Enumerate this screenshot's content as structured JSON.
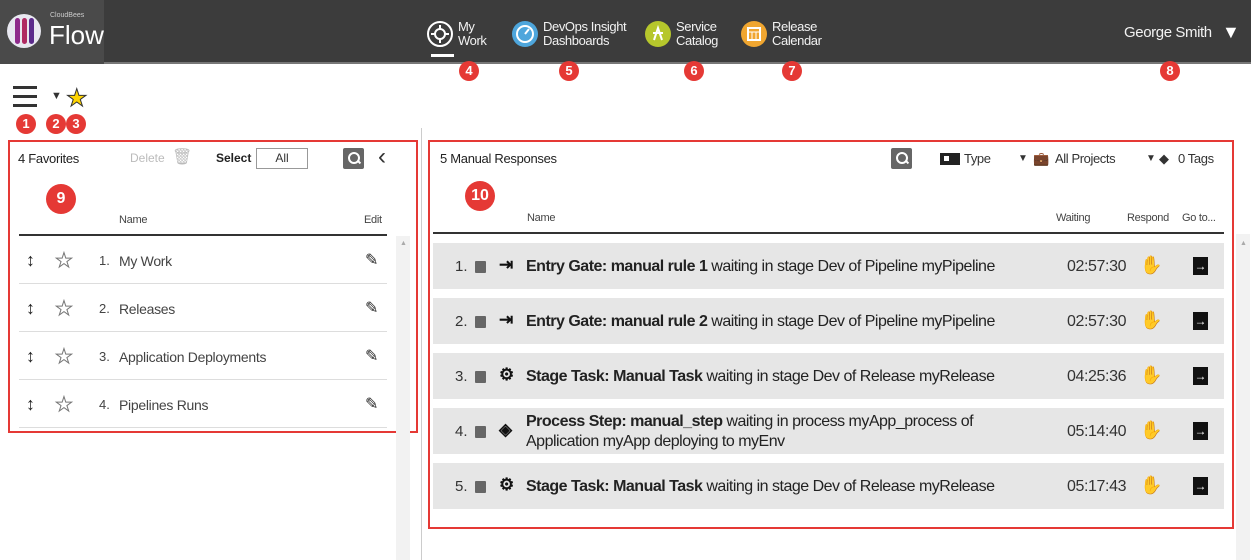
{
  "colors": {
    "accent": "#e53935",
    "topbar": "#3c3c3c",
    "star": "#ffd400"
  },
  "logo": {
    "small": "CloudBees",
    "name": "Flow"
  },
  "nav": [
    {
      "label": "My\nWork",
      "icon": "my-work-icon",
      "color": "#ffffff"
    },
    {
      "label": "DevOps Insight\nDashboards",
      "icon": "dashboard-gauge-icon",
      "color": "#4ea6dc"
    },
    {
      "label": "Service\nCatalog",
      "icon": "service-catalog-icon",
      "color": "#b6c72c"
    },
    {
      "label": "Release\nCalendar",
      "icon": "calendar-icon",
      "color": "#f0a630"
    }
  ],
  "user": {
    "name": "George Smith",
    "menu_icon": "caret-down-icon"
  },
  "toolbar": {
    "menu_icon": "hamburger-icon",
    "favorites_icon": "star-icon",
    "dropdown_icon": "caret-down-icon"
  },
  "callouts": [
    "1",
    "2",
    "3",
    "4",
    "5",
    "6",
    "7",
    "8",
    "9",
    "10"
  ],
  "favorites": {
    "title": "4 Favorites",
    "delete_label": "Delete",
    "select_label": "Select",
    "select_value": "All",
    "col_name": "Name",
    "col_edit": "Edit",
    "items": [
      {
        "num": "1.",
        "name": "My Work"
      },
      {
        "num": "2.",
        "name": "Releases"
      },
      {
        "num": "3.",
        "name": "Application Deployments"
      },
      {
        "num": "4.",
        "name": "Pipelines Runs"
      }
    ]
  },
  "responses": {
    "title": "5 Manual Responses",
    "filter_type": "Type",
    "filter_projects": "All Projects",
    "filter_tags": "0 Tags",
    "col_name": "Name",
    "col_waiting": "Waiting",
    "col_respond": "Respond",
    "col_goto": "Go to...",
    "rows": [
      {
        "num": "1.",
        "kind_icon": "gate-icon",
        "bold": "Entry Gate: manual rule 1",
        "rest": " waiting in stage Dev of Pipeline myPipeline",
        "time": "02:57:30"
      },
      {
        "num": "2.",
        "kind_icon": "gate-icon",
        "bold": "Entry Gate: manual rule 2",
        "rest": " waiting in stage Dev of Pipeline myPipeline",
        "time": "02:57:30"
      },
      {
        "num": "3.",
        "kind_icon": "gear-icon",
        "bold": "Stage Task: Manual Task",
        "rest": " waiting in stage Dev of Release myRelease",
        "time": "04:25:36"
      },
      {
        "num": "4.",
        "kind_icon": "process-step-icon",
        "bold": "Process Step: manual_step",
        "rest": " waiting in process myApp_process of Application myApp deploying to myEnv",
        "time": "05:14:40"
      },
      {
        "num": "5.",
        "kind_icon": "gear-icon",
        "bold": "Stage Task: Manual Task",
        "rest": " waiting in stage Dev of Release myRelease",
        "time": "05:17:43"
      }
    ]
  }
}
